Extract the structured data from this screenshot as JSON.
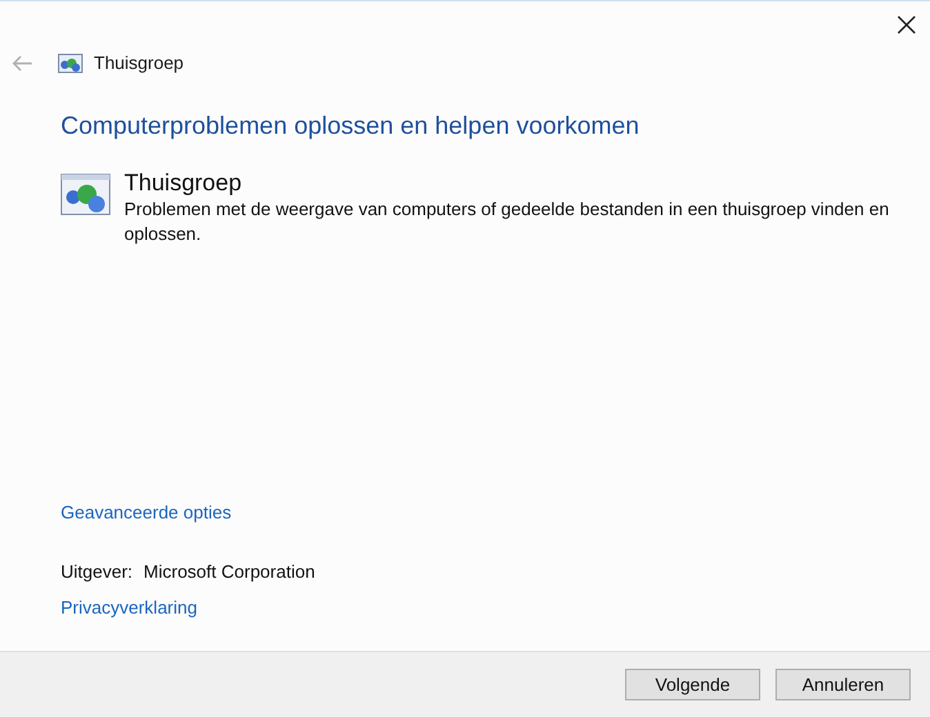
{
  "window": {
    "title": "Thuisgroep",
    "back_disabled": true
  },
  "heading": "Computerproblemen oplossen en helpen voorkomen",
  "troubleshooter": {
    "title": "Thuisgroep",
    "description": "Problemen met de weergave van computers of gedeelde bestanden in een thuisgroep vinden en oplossen."
  },
  "advanced_link": "Geavanceerde opties",
  "publisher": {
    "label": "Uitgever:",
    "value": "Microsoft Corporation"
  },
  "privacy_link": "Privacyverklaring",
  "buttons": [
    "Volgende",
    "Annuleren"
  ]
}
